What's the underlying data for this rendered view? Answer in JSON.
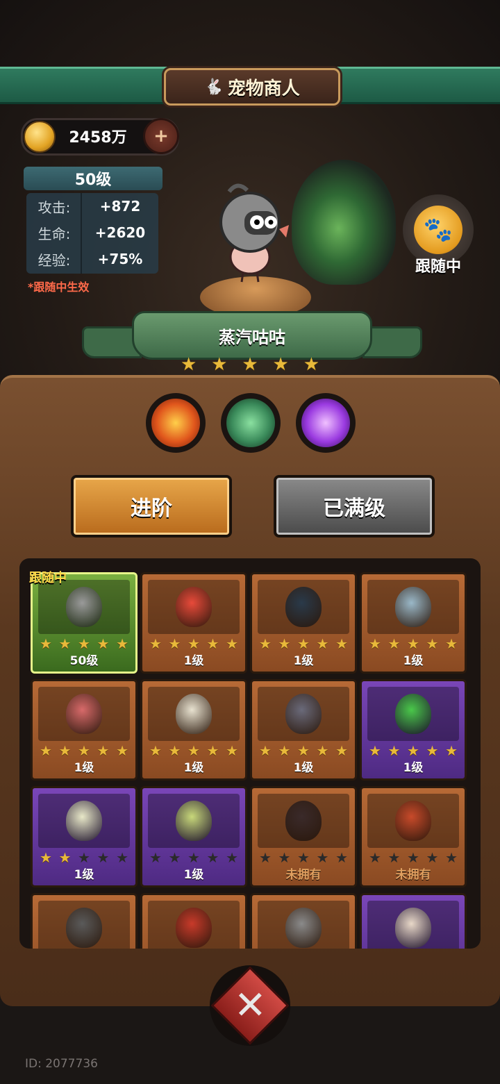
{
  "header": {
    "title": "宠物商人"
  },
  "currency": {
    "amount": "2458万",
    "add_label": "+"
  },
  "pet_stats": {
    "level": "50级",
    "rows": [
      {
        "key": "攻击:",
        "value": "+872"
      },
      {
        "key": "生命:",
        "value": "+2620"
      },
      {
        "key": "经验:",
        "value": "+75%"
      }
    ],
    "note": "*跟随中生效"
  },
  "pet": {
    "name": "蒸汽咕咕",
    "stars": 5,
    "follow_label": "跟随中"
  },
  "skills": [
    {
      "icon": "fire-skill-icon",
      "color": "#e0561c"
    },
    {
      "icon": "claw-skill-icon",
      "color": "#3a8a5a"
    },
    {
      "icon": "speech-skill-icon",
      "color": "#9a3ae0"
    }
  ],
  "buttons": {
    "advance": "进阶",
    "maxed": "已满级"
  },
  "grid": {
    "active_tag": "跟随中",
    "cards": [
      {
        "theme": "active",
        "stars": 5,
        "label": "50级",
        "avatar_color": "#9a9a9a"
      },
      {
        "theme": "orange",
        "stars": 5,
        "label": "1级",
        "avatar_color": "#e84a3a"
      },
      {
        "theme": "orange",
        "stars": 5,
        "label": "1级",
        "avatar_color": "#2a3a4a"
      },
      {
        "theme": "orange",
        "stars": 5,
        "label": "1级",
        "avatar_color": "#9ab8c8"
      },
      {
        "theme": "orange",
        "stars": 5,
        "label": "1级",
        "avatar_color": "#d86a6a"
      },
      {
        "theme": "orange",
        "stars": 5,
        "label": "1级",
        "avatar_color": "#e8e2d0"
      },
      {
        "theme": "orange",
        "stars": 5,
        "label": "1级",
        "avatar_color": "#6a6a7a"
      },
      {
        "theme": "purple",
        "stars": 5,
        "label": "1级",
        "avatar_color": "#4ac84a"
      },
      {
        "theme": "purple",
        "stars": 2,
        "label": "1级",
        "avatar_color": "#e8e8c8"
      },
      {
        "theme": "purple",
        "stars": 0,
        "label": "1级",
        "avatar_color": "#c8d87a"
      },
      {
        "theme": "orange",
        "stars": 0,
        "label": "未拥有",
        "avatar_color": "#3a2a2a"
      },
      {
        "theme": "orange",
        "stars": 0,
        "label": "未拥有",
        "avatar_color": "#c84a2a"
      },
      {
        "theme": "orange",
        "stars": 0,
        "label": "",
        "avatar_color": "#5a5a5a"
      },
      {
        "theme": "orange",
        "stars": 0,
        "label": "",
        "avatar_color": "#c83a2a"
      },
      {
        "theme": "orange",
        "stars": 0,
        "label": "",
        "avatar_color": "#8a8a8a"
      },
      {
        "theme": "purple",
        "stars": 0,
        "label": "",
        "avatar_color": "#e8d8c8"
      }
    ]
  },
  "footer": {
    "uid": "ID: 2077736"
  }
}
